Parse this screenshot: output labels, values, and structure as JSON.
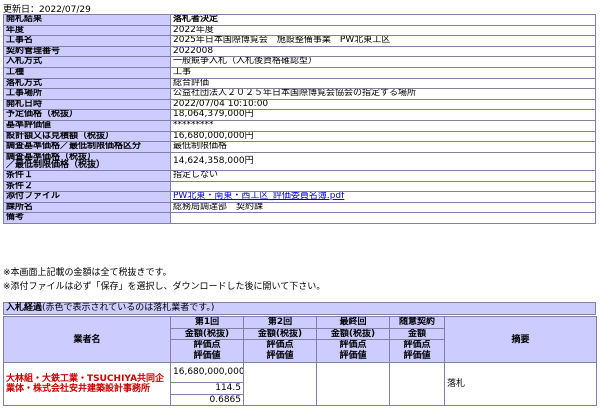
{
  "updated": "更新日：2022/07/29",
  "details": [
    {
      "label": "開札結果",
      "value": "落札者決定",
      "bold": true
    },
    {
      "label": "年度",
      "value": "2022年度"
    },
    {
      "label": "工事名",
      "value": "2025年日本国際博覧会　施設整備事業　PW北東工区"
    },
    {
      "label": "契約管理番号",
      "value": "2022008"
    },
    {
      "label": "入札方式",
      "value": "一般競争入札（入札後資格確認型）"
    },
    {
      "label": "工種",
      "value": "工事"
    },
    {
      "label": "落札方式",
      "value": "総合評価"
    },
    {
      "label": "工事場所",
      "value": "公益社団法人２０２５年日本国際博覧会協会の指定する場所"
    },
    {
      "label": "開札日時",
      "value": "2022/07/04 10:10:00"
    },
    {
      "label": "予定価格（税抜）",
      "value": "18,064,379,000円"
    },
    {
      "label": "基準評価値",
      "value": "*********"
    },
    {
      "label": "設計額又は見積額（税抜）",
      "value": "16,680,000,000円"
    },
    {
      "label": "調査基準価格／最低制限価格区分",
      "value": "最低制限価格"
    },
    {
      "label": "調査基準価格（税抜）\n／最低制限価格（税抜）",
      "value": "14,624,358,000円",
      "tall": true
    },
    {
      "label": "条件１",
      "value": "指定しない"
    },
    {
      "label": "条件２",
      "value": ""
    },
    {
      "label": "添付ファイル",
      "value": "PW北東・南東・西工区_評価委員名簿.pdf",
      "link": true
    },
    {
      "label": "課所名",
      "value": "総務局調達部　契約課"
    },
    {
      "label": "備考",
      "value": ""
    }
  ],
  "notes": [
    "※本画面上記載の金額は全て税抜きです。",
    "※添付ファイルは必ず「保存」を選択し、ダウンロードした後に開いて下さい。"
  ],
  "bid_section": {
    "title": "入札経過",
    "subtitle": "(赤色で表示されているのは落札業者です。)",
    "headers": {
      "vendor": "業者名",
      "round1": "第1回",
      "round2": "第2回",
      "final": "最終回",
      "negotiation": "随意契約",
      "amount_tax": "金額(税抜)",
      "amount": "金額",
      "eval_score": "評価点",
      "eval_value": "評価値",
      "summary": "摘要"
    },
    "rows": [
      {
        "vendor": "大林組・大鉄工業・TSUCHIYA共同企業体・株式会社安井建築設計事務所",
        "amount": "16,680,000,000",
        "eval_score": "114.5",
        "eval_value": "0.6865",
        "summary": "落札"
      }
    ]
  }
}
